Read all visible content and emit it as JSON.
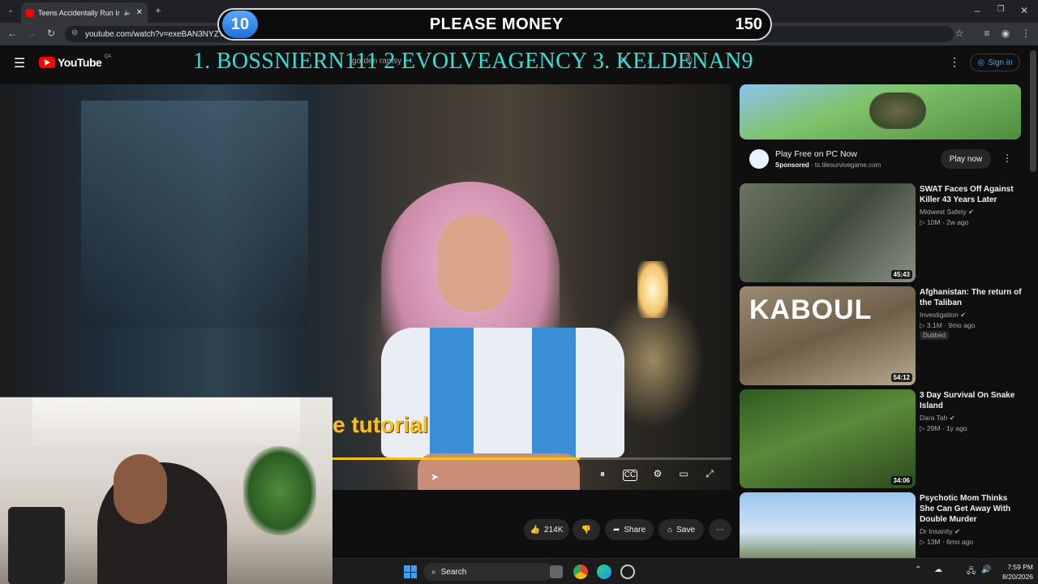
{
  "browser": {
    "tab_title": "Teens Accidentally Run Inte",
    "url": "youtube.com/watch?v=exeBAN3NYZY"
  },
  "overlay": {
    "count": "10",
    "title": "PLEASE MONEY",
    "goal": "150",
    "leaderboard": "1. BOSSNIERN111 2 EVOLVEAGENCY   3. KELDENAN9"
  },
  "youtube": {
    "logo": "YouTube",
    "country": "QA",
    "search_query": "gorden ramsy",
    "sign_in": "Sign in"
  },
  "video": {
    "caption": "e tutorial",
    "progress": 0.62,
    "likes": "214K",
    "share": "Share",
    "save": "Save"
  },
  "ad": {
    "title": "Play Free on PC Now",
    "sponsored": "Sponsored",
    "domain": "ts.tilesurvivegame.com",
    "cta": "Play now"
  },
  "recommendations": [
    {
      "title": "SWAT Faces Off Against Killer 43 Years Later",
      "channel": "Midwest Safety",
      "views": "10M",
      "age": "2w ago",
      "duration": "45:43"
    },
    {
      "title": "Afghanistan: The return of the Taliban",
      "channel": "Investigation",
      "views": "3.1M",
      "age": "9mo ago",
      "duration": "54:12",
      "badge": "Dubbed",
      "thumb_text": "KABOUL"
    },
    {
      "title": "3 Day Survival On Snake Island",
      "channel": "Dara Tah",
      "views": "29M",
      "age": "1y ago",
      "duration": "34:06"
    },
    {
      "title": "Psychotic Mom Thinks She Can Get Away With Double Murder",
      "channel": "Dr Insanity",
      "views": "13M",
      "age": "6mo ago"
    }
  ],
  "taskbar": {
    "search": "Search",
    "time": "7:59 PM",
    "date": "8/20/2026"
  }
}
